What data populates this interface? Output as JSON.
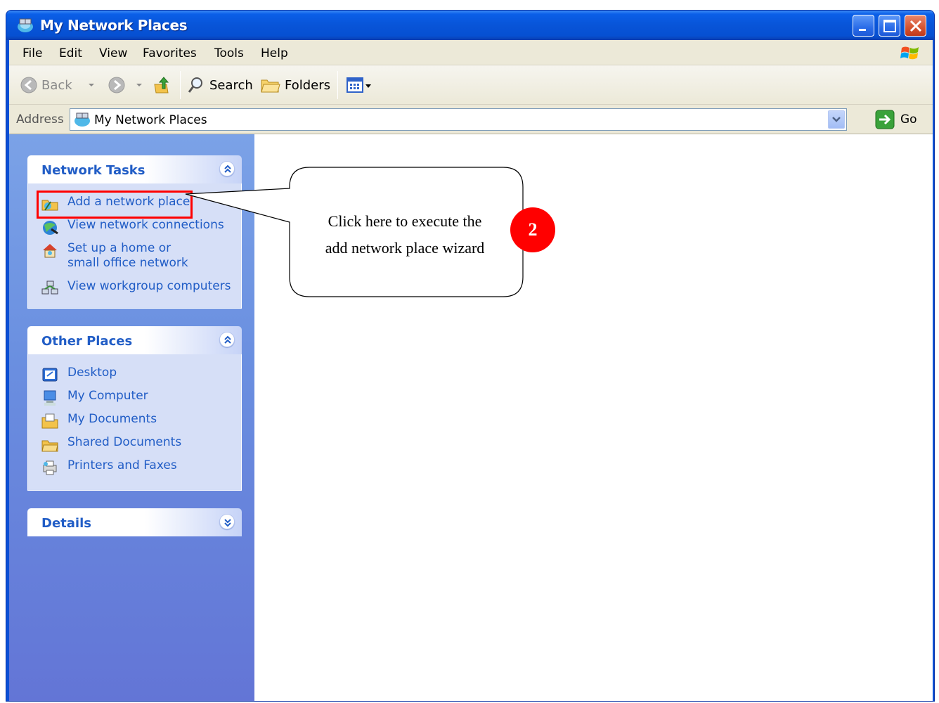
{
  "window": {
    "title": "My Network Places"
  },
  "menu": {
    "items": [
      "File",
      "Edit",
      "View",
      "Favorites",
      "Tools",
      "Help"
    ]
  },
  "toolbar": {
    "back_label": "Back",
    "search_label": "Search",
    "folders_label": "Folders"
  },
  "address": {
    "label": "Address",
    "value": "My Network Places",
    "go_label": "Go"
  },
  "network_tasks": {
    "title": "Network Tasks",
    "items": [
      {
        "label": "Add a network place",
        "icon": "add-network-place-icon"
      },
      {
        "label": "View network connections",
        "icon": "network-connections-icon"
      },
      {
        "label": "Set up a home or small office network",
        "icon": "home-network-icon"
      },
      {
        "label": "View workgroup computers",
        "icon": "workgroup-icon"
      }
    ]
  },
  "other_places": {
    "title": "Other Places",
    "items": [
      {
        "label": "Desktop",
        "icon": "desktop-icon"
      },
      {
        "label": "My Computer",
        "icon": "my-computer-icon"
      },
      {
        "label": "My Documents",
        "icon": "my-documents-icon"
      },
      {
        "label": "Shared Documents",
        "icon": "shared-folder-icon"
      },
      {
        "label": "Printers and Faxes",
        "icon": "printers-icon"
      }
    ]
  },
  "details": {
    "title": "Details"
  },
  "annotation": {
    "text_line1": "Click here to execute the",
    "text_line2": "add network place wizard",
    "badge": "2",
    "highlight_color": "#ff0000"
  },
  "colors": {
    "titlebar": "#0854d8",
    "sidepane": "#6a8fe0",
    "link": "#215dc6"
  }
}
